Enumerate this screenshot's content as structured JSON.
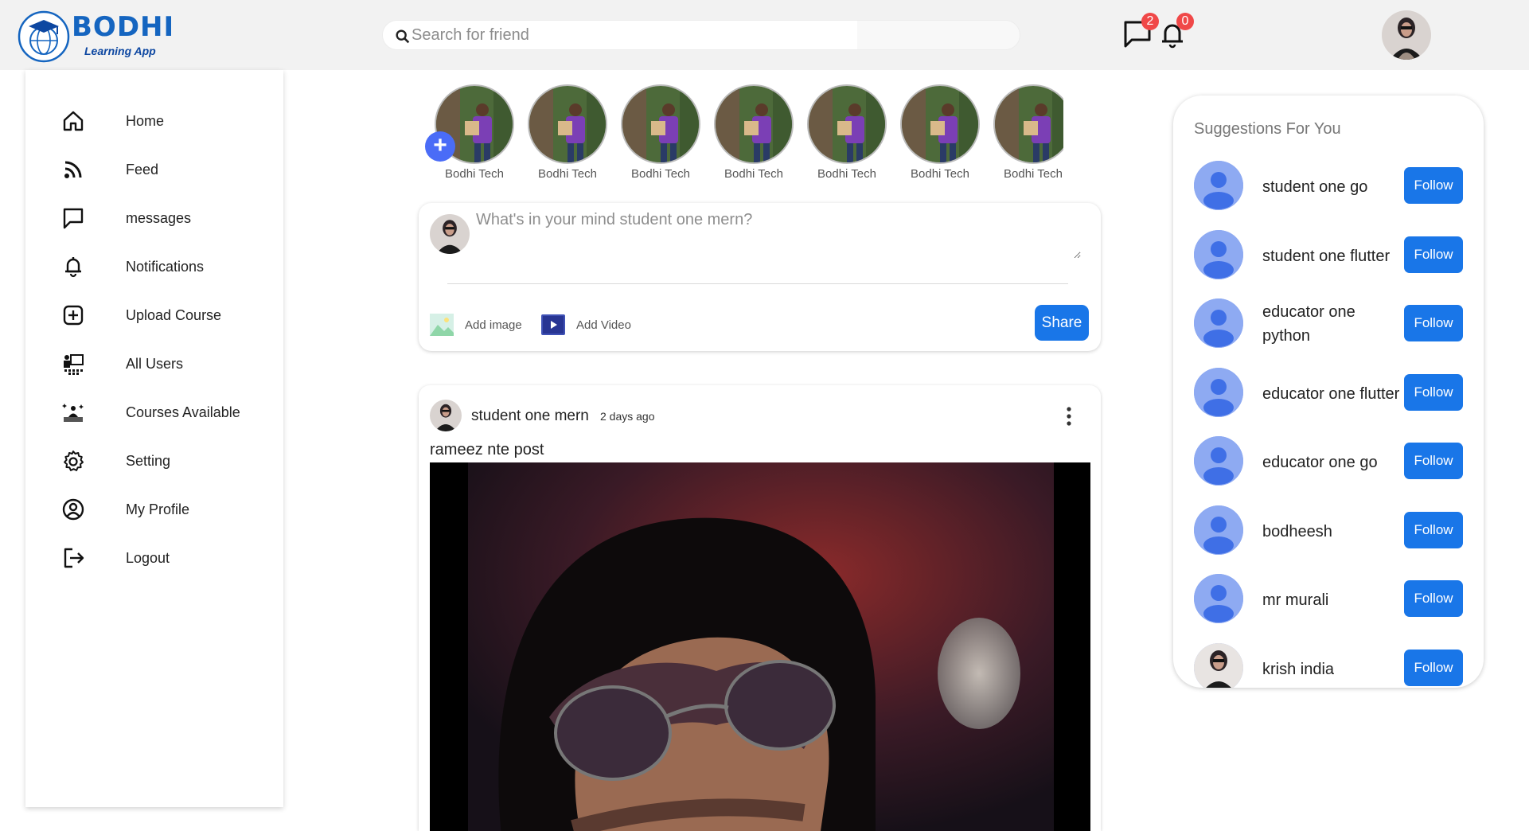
{
  "app": {
    "logo_word": "BODHI",
    "logo_sub": "Learning App"
  },
  "search": {
    "placeholder": "Search for friend",
    "value": ""
  },
  "header": {
    "messages_badge": "2",
    "notifications_badge": "0"
  },
  "sidebar": {
    "items": [
      {
        "label": "Home",
        "icon": "home-icon"
      },
      {
        "label": "Feed",
        "icon": "rss-icon"
      },
      {
        "label": "messages",
        "icon": "chat-icon"
      },
      {
        "label": "Notifications",
        "icon": "bell-icon"
      },
      {
        "label": "Upload Course",
        "icon": "plus-square-icon"
      },
      {
        "label": "All Users",
        "icon": "users-icon"
      },
      {
        "label": "Courses Available",
        "icon": "courses-icon"
      },
      {
        "label": "Setting",
        "icon": "gear-icon"
      },
      {
        "label": "My Profile",
        "icon": "user-circle-icon"
      },
      {
        "label": "Logout",
        "icon": "logout-icon"
      }
    ]
  },
  "stories": [
    {
      "name": "Bodhi Tech"
    },
    {
      "name": "Bodhi Tech"
    },
    {
      "name": "Bodhi Tech"
    },
    {
      "name": "Bodhi Tech"
    },
    {
      "name": "Bodhi Tech"
    },
    {
      "name": "Bodhi Tech"
    },
    {
      "name": "Bodhi Tech"
    }
  ],
  "composer": {
    "placeholder": "What's in your mind student one mern?",
    "add_image": "Add image",
    "add_video": "Add Video",
    "share": "Share"
  },
  "post": {
    "author": "student one mern",
    "time": "2 days ago",
    "text": "rameez nte post"
  },
  "suggestions": {
    "title": "Suggestions For You",
    "follow_label": "Follow",
    "users": [
      {
        "name": "student one go"
      },
      {
        "name": "student one flutter"
      },
      {
        "name": "educator one python"
      },
      {
        "name": "educator one flutter"
      },
      {
        "name": "educator one go"
      },
      {
        "name": "bodheesh"
      },
      {
        "name": "mr murali"
      },
      {
        "name": "krish india"
      }
    ]
  },
  "colors": {
    "primary": "#1976e8",
    "badge": "#f04848",
    "accent_story": "#4a6cf7",
    "topbar": "#f2f2f2"
  }
}
